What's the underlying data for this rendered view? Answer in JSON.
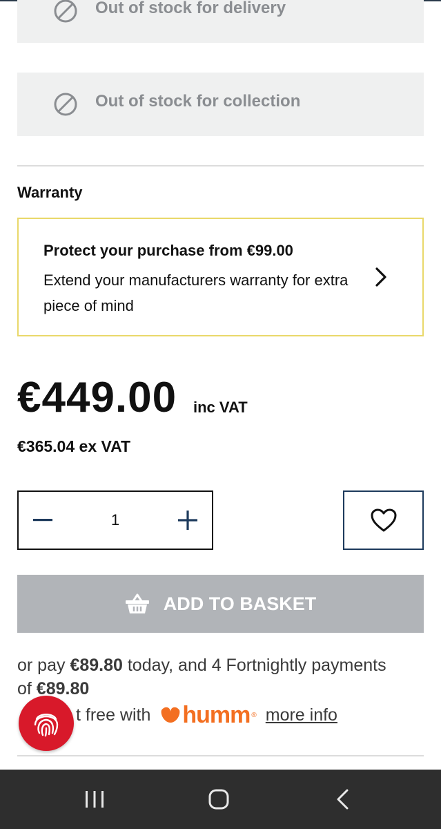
{
  "availability": {
    "delivery_text": "Out of stock for delivery",
    "collection_text": "Out of stock for collection",
    "icon": "unavailable-icon"
  },
  "warranty": {
    "section_title": "Warranty",
    "headline": "Protect your purchase from €99.00",
    "body": "Extend your manufacturers warranty for extra piece of mind",
    "border_color": "#e9d86a"
  },
  "price": {
    "inc_vat": "€449.00",
    "inc_vat_label": "inc VAT",
    "ex_vat": "€365.04",
    "ex_vat_label": "ex VAT"
  },
  "quantity": {
    "value": "1",
    "decrement_symbol": "−",
    "increment_symbol": "+"
  },
  "actions": {
    "add_to_basket": "ADD TO BASKET",
    "basket_disabled_color": "#b1b4b8",
    "wishlist_icon": "heart-icon"
  },
  "payment": {
    "prefix": "or pay ",
    "today_amount": "€89.80",
    "middle": " today, and 4 Fortnightly payments of ",
    "installment_amount": "€89.80",
    "interest_text": "t free with",
    "provider": "humm",
    "provider_color": "#f36f21",
    "more_info": "more info"
  },
  "nav": {
    "recents_icon": "recent-apps-icon",
    "home_icon": "home-icon",
    "back_icon": "back-icon"
  }
}
